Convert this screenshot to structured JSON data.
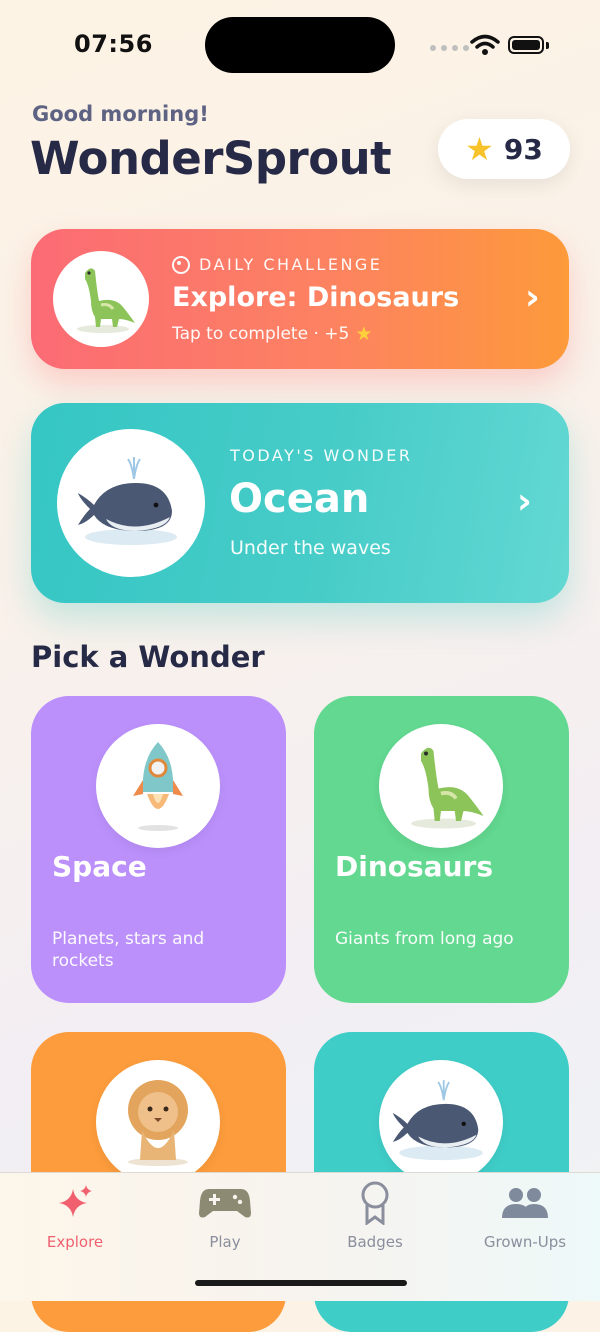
{
  "status_bar": {
    "time": "07:56"
  },
  "header": {
    "greeting": "Good morning!",
    "app_title": "WonderSprout",
    "points": "93",
    "points_icon": "star-icon"
  },
  "daily_challenge": {
    "eyebrow": "DAILY CHALLENGE",
    "title": "Explore: Dinosaurs",
    "subtitle": "Tap to complete · +5",
    "image": "dinosaur-illustration",
    "colors": [
      "#fb6b75",
      "#fd9a3a"
    ]
  },
  "todays_wonder": {
    "eyebrow": "TODAY'S WONDER",
    "title": "Ocean",
    "subtitle": "Under the waves",
    "image": "whale-illustration",
    "colors": [
      "#35c6c4",
      "#63d8d3"
    ]
  },
  "section": {
    "title": "Pick a Wonder"
  },
  "wonders": [
    {
      "title": "Space",
      "subtitle": "Planets, stars and rockets",
      "image": "rocket-illustration",
      "color": "#bb90fb"
    },
    {
      "title": "Dinosaurs",
      "subtitle": "Giants from long ago",
      "image": "dinosaur-illustration",
      "color": "#62d890"
    },
    {
      "title": "",
      "subtitle": "",
      "image": "lion-cub-illustration",
      "color": "#fc9c3c"
    },
    {
      "title": "",
      "subtitle": "",
      "image": "whale-illustration",
      "color": "#3fcdc8"
    }
  ],
  "tabbar": {
    "active": "Explore",
    "tabs": [
      {
        "label": "Explore",
        "icon": "sparkles-icon"
      },
      {
        "label": "Play",
        "icon": "gamepad-icon"
      },
      {
        "label": "Badges",
        "icon": "medal-icon"
      },
      {
        "label": "Grown-Ups",
        "icon": "people-icon"
      }
    ]
  }
}
